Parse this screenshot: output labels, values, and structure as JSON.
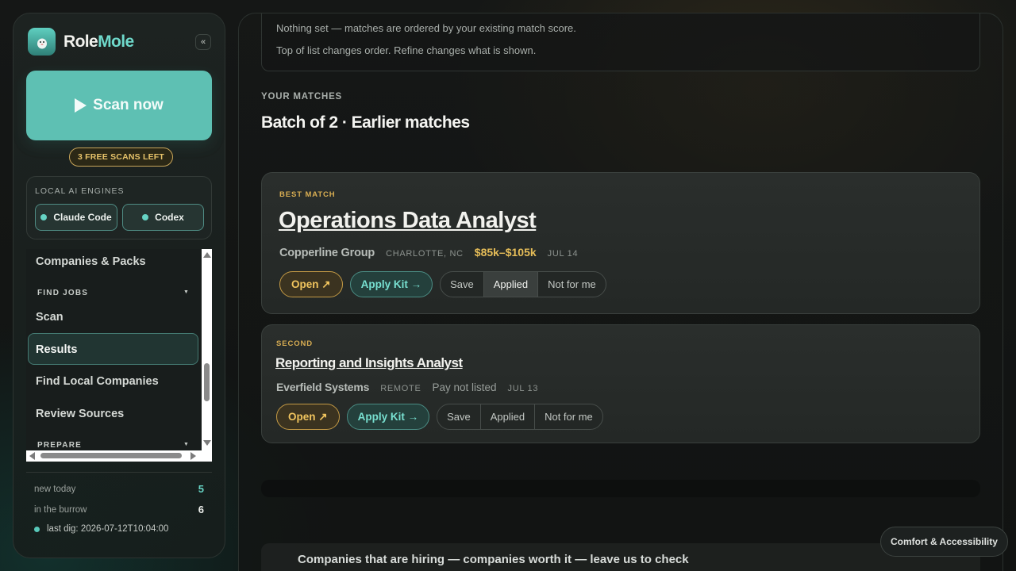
{
  "app": {
    "brand_part1": "Role",
    "brand_part2": "Mole"
  },
  "colors": {
    "accent_teal": "#5ec0b3",
    "accent_gold": "#e6bd58",
    "background": "#141615"
  },
  "sidebar": {
    "scan_label": "Scan now",
    "free_scans": "3 FREE SCANS LEFT",
    "engines_title": "LOCAL AI ENGINES",
    "engines": [
      "Claude Code",
      "Codex"
    ],
    "nav": {
      "companies_packs": "Companies & Packs",
      "find_jobs_section": "FIND JOBS",
      "scan": "Scan",
      "results": "Results",
      "find_local": "Find Local Companies",
      "review_sources": "Review Sources",
      "prepare_section": "PREPARE"
    },
    "stats": {
      "new_today_label": "new today",
      "new_today_value": "5",
      "burrow_label": "in the burrow",
      "burrow_value": "6",
      "last_dig": "last dig: 2026-07-12T10:04:00"
    }
  },
  "main": {
    "refine_line1": "Nothing set — matches are ordered by your existing match score.",
    "refine_line2": "Top of list changes order. Refine changes what is shown.",
    "kicker": "YOUR MATCHES",
    "batch_title": "Batch of 2 · Earlier matches",
    "cards": [
      {
        "label": "BEST MATCH",
        "title": "Operations Data Analyst",
        "company": "Copperline Group",
        "location": "CHARLOTTE, NC",
        "pay": "$85k–$105k",
        "date": "JUL 14",
        "open": "Open ↗",
        "apply_kit": "Apply Kit →",
        "save": "Save",
        "applied": "Applied",
        "not_for_me": "Not for me",
        "state": "Applied"
      },
      {
        "label": "SECOND",
        "title": "Reporting and Insights Analyst",
        "company": "Everfield Systems",
        "location": "REMOTE",
        "pay": "Pay not listed",
        "date": "JUL 13",
        "open": "Open ↗",
        "apply_kit": "Apply Kit →",
        "save": "Save",
        "applied": "Applied",
        "not_for_me": "Not for me"
      }
    ],
    "cut_text": "Companies that are hiring — companies worth it — leave us to check"
  },
  "comfort_button": "Comfort & Accessibility"
}
